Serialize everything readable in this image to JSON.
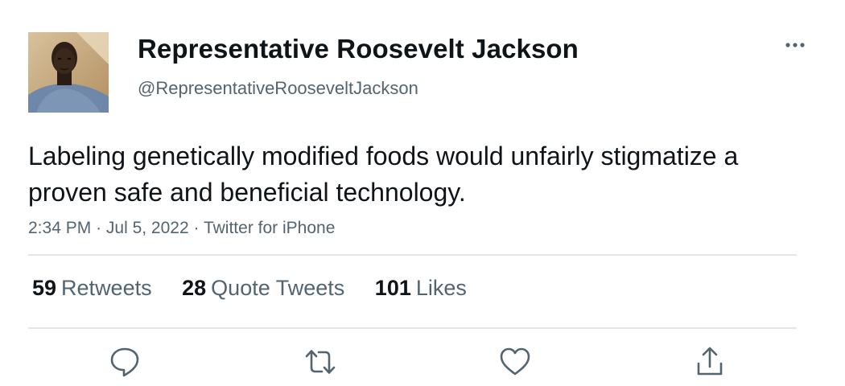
{
  "author": {
    "display_name": "Representative Roosevelt Jackson",
    "handle": "@RepresentativeRooseveltJackson",
    "avatar_icon": "profile-photo"
  },
  "tweet": {
    "text": "Labeling genetically modified foods would unfairly stigmatize a proven safe and beneficial technology.",
    "time": "2:34 PM",
    "separator": "·",
    "date": "Jul 5, 2022",
    "source": "Twitter for iPhone"
  },
  "stats": {
    "retweets": {
      "count": "59",
      "label": "Retweets"
    },
    "quote_tweets": {
      "count": "28",
      "label": "Quote Tweets"
    },
    "likes": {
      "count": "101",
      "label": "Likes"
    }
  },
  "actions": {
    "reply_icon": "reply-icon",
    "retweet_icon": "retweet-icon",
    "like_icon": "heart-icon",
    "share_icon": "share-icon",
    "more_icon": "more-icon"
  },
  "colors": {
    "text_primary": "#0f1419",
    "text_secondary": "#536471",
    "divider": "#e3e6e9"
  }
}
